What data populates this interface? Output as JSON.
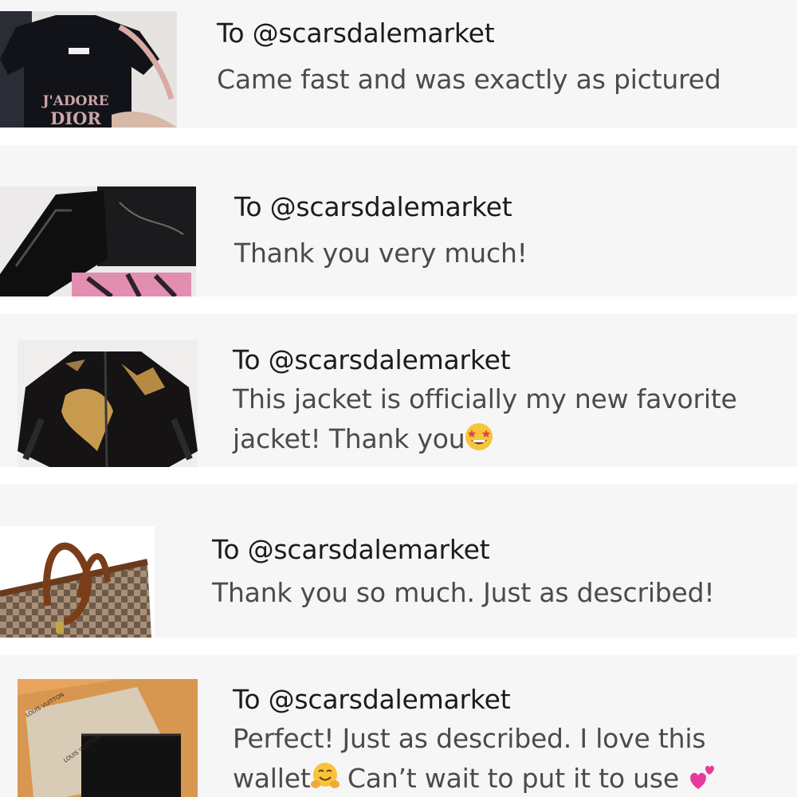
{
  "reviews": [
    {
      "recipient": "To @scarsdalemarket",
      "message": "Came fast and was exactly as pictured",
      "thumbnail_icon": "black-dior-tshirt-photo",
      "thumbnail_text_1": "J'ADORE",
      "thumbnail_text_2": "DIOR"
    },
    {
      "recipient": "To @scarsdalemarket",
      "message": "Thank you very much!",
      "thumbnail_icon": "black-leather-boots-photo"
    },
    {
      "recipient": "To @scarsdalemarket",
      "message_line_1": "This jacket is officially my new favorite",
      "message_line_2": "jacket! Thank you",
      "emoji": "star-struck-emoji",
      "thumbnail_icon": "black-gold-leather-jacket-photo"
    },
    {
      "recipient": "To @scarsdalemarket",
      "message": "Thank you so much. Just as described!",
      "thumbnail_icon": "checkered-tote-bag-photo"
    },
    {
      "recipient": "To @scarsdalemarket",
      "message_line_1": "Perfect! Just as described. I love this",
      "message_line_2_part_1": "wallet",
      "message_line_2_part_2": " Can’t wait to put it to use ",
      "emoji_1": "hugging-face-emoji",
      "emoji_2": "two-hearts-emoji",
      "thumbnail_icon": "louis-vuitton-wallet-box-photo",
      "thumbnail_text_1": "LOUIS VUITTON",
      "thumbnail_text_2": "LOUIS VUITTON"
    }
  ],
  "colors": {
    "card_background": "#f6f6f7",
    "page_background": "#ffffff",
    "recipient_text": "#1b1b1b",
    "message_text": "#4b4b4b"
  }
}
